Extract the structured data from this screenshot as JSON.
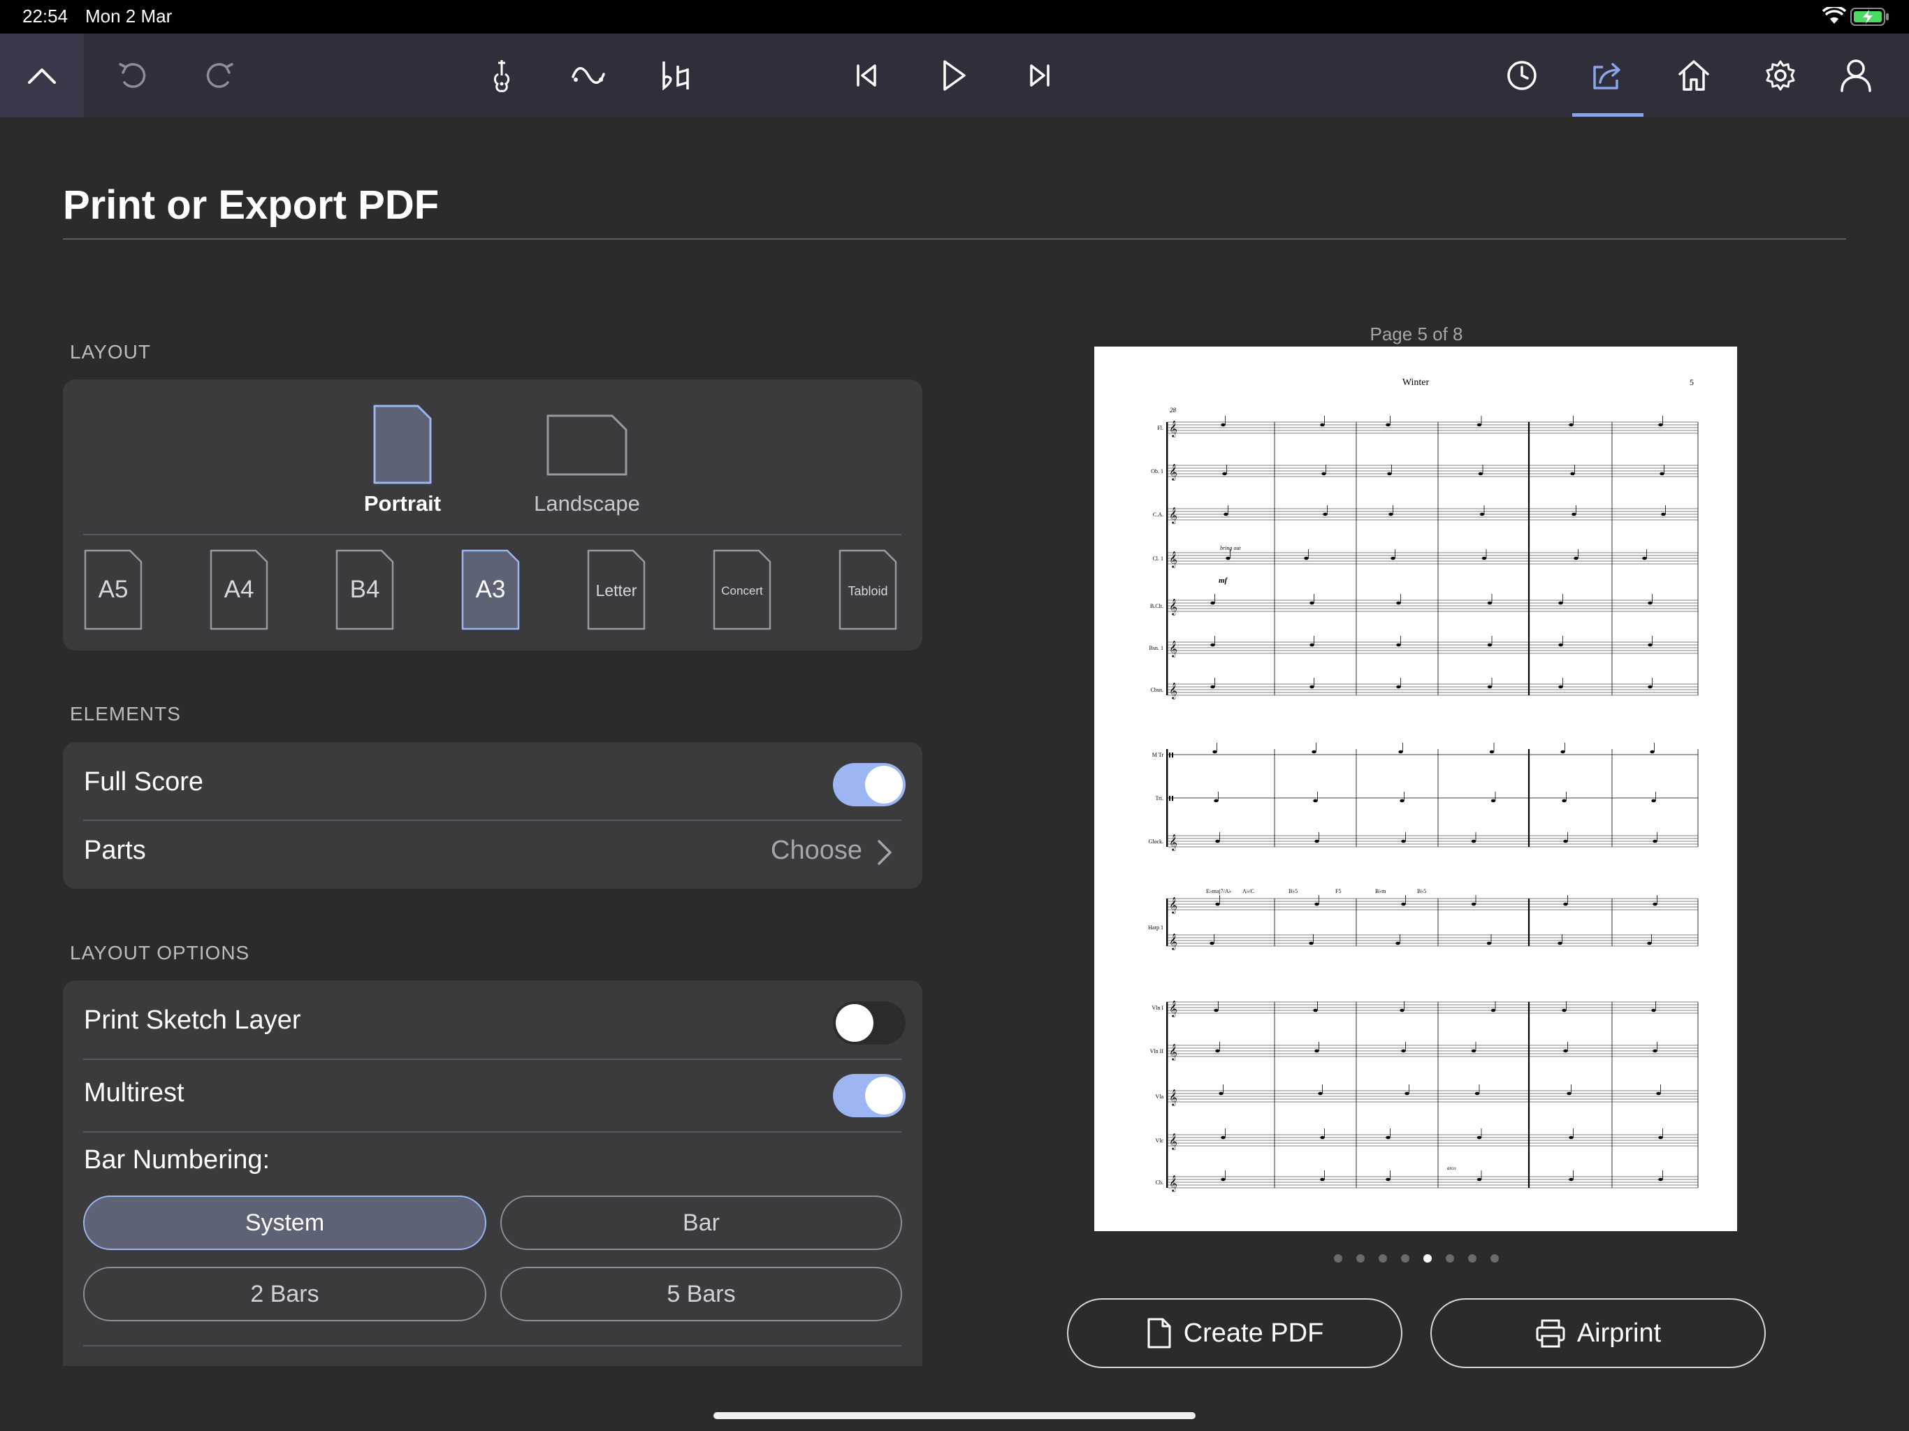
{
  "status_bar": {
    "time": "22:54",
    "date": "Mon 2 Mar"
  },
  "toolbar": {
    "icons": [
      "chevron-up-icon",
      "undo-icon",
      "redo-icon",
      "tuning-fork-icon",
      "slur-icon",
      "accidentals-icon",
      "skip-back-icon",
      "play-icon",
      "skip-forward-icon",
      "history-icon",
      "share-icon",
      "home-icon",
      "settings-gear-icon",
      "account-icon"
    ],
    "active": "share-icon",
    "accent_color": "#8aa6e6"
  },
  "page": {
    "title": "Print or Export PDF"
  },
  "layout": {
    "section_label": "LAYOUT",
    "orientations": [
      {
        "label": "Portrait",
        "selected": true
      },
      {
        "label": "Landscape",
        "selected": false
      }
    ],
    "paper_sizes": [
      {
        "label": "A5",
        "selected": false
      },
      {
        "label": "A4",
        "selected": false
      },
      {
        "label": "B4",
        "selected": false
      },
      {
        "label": "A3",
        "selected": true
      },
      {
        "label": "Letter",
        "selected": false
      },
      {
        "label": "Concert",
        "selected": false
      },
      {
        "label": "Tabloid",
        "selected": false
      }
    ]
  },
  "elements": {
    "section_label": "ELEMENTS",
    "full_score": {
      "label": "Full Score",
      "on": true
    },
    "parts": {
      "label": "Parts",
      "value": "Choose"
    }
  },
  "layout_options": {
    "section_label": "LAYOUT OPTIONS",
    "print_sketch_layer": {
      "label": "Print Sketch Layer",
      "on": false
    },
    "multirest": {
      "label": "Multirest",
      "on": true
    },
    "bar_numbering": {
      "label": "Bar Numbering:",
      "options": [
        "System",
        "Bar",
        "2 Bars",
        "5 Bars"
      ],
      "selected": "System"
    }
  },
  "preview": {
    "caption": "Page 5 of 8",
    "total_pages": 8,
    "current_page": 5,
    "score_title": "Winter",
    "page_number": "5",
    "bar_number": "28",
    "instruments_group1": [
      "Fl.",
      "Ob. 1",
      "C.A.",
      "Cl. 1",
      "B.Clt.",
      "Bsn. 1",
      "Cbsn."
    ],
    "instruments_group2": [
      "M Tr",
      "Tri.",
      "Glock."
    ],
    "harp": "Harp 1",
    "chord_symbols": [
      "E♭maj7/A♭",
      "A♭/C",
      "B♭5",
      "F5",
      "B♭m",
      "B♭5"
    ],
    "instruments_group3": [
      "Vln I",
      "Vln II",
      "Vla",
      "Vlc",
      "Cb."
    ],
    "expression_text": "bring out",
    "dynamic": "mf",
    "articulation": "arco"
  },
  "actions": {
    "create_pdf": "Create PDF",
    "airprint": "Airprint"
  }
}
